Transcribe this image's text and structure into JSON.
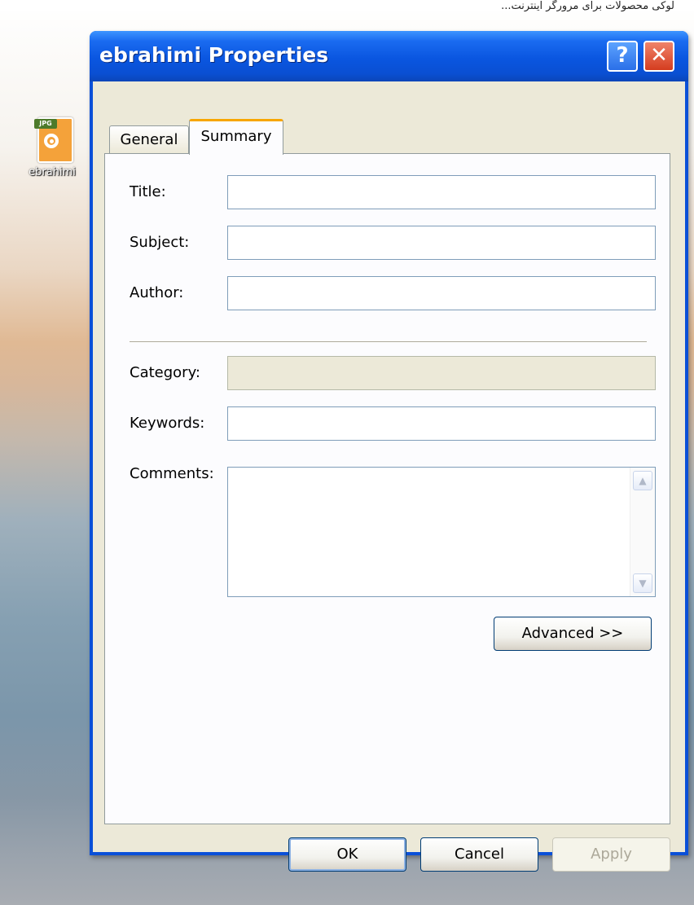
{
  "top_text": "لوکی محصولات برای مرورگر اینترنت...",
  "desktop": {
    "icon_label": "ebrahimi",
    "icon_badge": "JPG"
  },
  "window": {
    "title": "ebrahimi Properties",
    "help_glyph": "?",
    "close_glyph": "✕",
    "tabs": [
      {
        "label": "General",
        "active": false
      },
      {
        "label": "Summary",
        "active": true
      }
    ],
    "fields": {
      "title_label": "Title:",
      "title_value": "",
      "subject_label": "Subject:",
      "subject_value": "",
      "author_label": "Author:",
      "author_value": "",
      "category_label": "Category:",
      "category_value": "",
      "keywords_label": "Keywords:",
      "keywords_value": "",
      "comments_label": "Comments:",
      "comments_value": ""
    },
    "buttons": {
      "advanced": "Advanced >>",
      "ok": "OK",
      "cancel": "Cancel",
      "apply": "Apply"
    }
  },
  "icons": [
    "jpg-file-icon",
    "help-icon",
    "close-icon",
    "scroll-up-icon",
    "scroll-down-icon"
  ],
  "colors": {
    "titlebar": "#0a56e0",
    "dialog_bg": "#ece9d8",
    "close_button": "#d43c1f",
    "tab_highlight": "#f7a600"
  }
}
